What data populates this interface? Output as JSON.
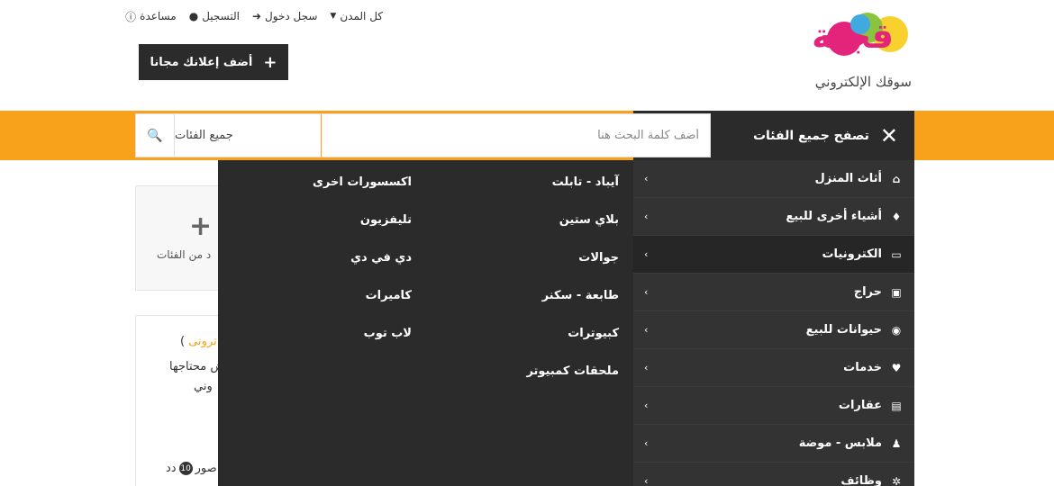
{
  "topnav": {
    "cities": "كل المدن",
    "login": "سجل دخول",
    "register": "التسجيل",
    "help": "مساعدة"
  },
  "logo": {
    "wordmark": "قجنة",
    "tagline": "سوقك الإلكتروني"
  },
  "post_ad": {
    "label": "أضف إعلانك مجانا",
    "icon": "plus-icon"
  },
  "browse": {
    "label": "تصفح جميع الفئات",
    "icon": "close-icon"
  },
  "search": {
    "placeholder": "أضف كلمة البحث هنا",
    "category_selected": "جميع الفئات",
    "icon": "search-icon"
  },
  "categories": [
    {
      "label": "أثاث المنزل",
      "icon": "home-icon"
    },
    {
      "label": "أشياء أخرى للبيع",
      "icon": "bell-icon"
    },
    {
      "label": "الكترونيات",
      "icon": "monitor-icon",
      "active": true
    },
    {
      "label": "حراج",
      "icon": "car-icon"
    },
    {
      "label": "حيوانات للبيع",
      "icon": "cat-icon"
    },
    {
      "label": "خدمات",
      "icon": "heart-icon"
    },
    {
      "label": "عقارات",
      "icon": "bank-icon"
    },
    {
      "label": "ملابس - موضة",
      "icon": "person-icon"
    },
    {
      "label": "وظائف",
      "icon": "gears-icon"
    }
  ],
  "subcategories": {
    "col1": [
      "آيباد - تابلت",
      "بلاي ستين",
      "جوالات",
      "طابعة - سكنر",
      "كبيوترات",
      "ملحقات كمبيوتر"
    ],
    "col2": [
      "اكسسورات اخرى",
      "تليفزيون",
      "دي في دي",
      "كاميرات",
      "لاب توب"
    ]
  },
  "background": {
    "more_text": "د من الفئات",
    "t1_prefix": ")",
    "t1_orange": "ترونى",
    "t2": "ش محتاجها",
    "t3": "وني",
    "photos_count": "10",
    "photos_prefix": "دد",
    "photos_suffix": "صور"
  },
  "colors": {
    "accent": "#f7a21a",
    "dark": "#2b2b2b",
    "brand": "#e3247a"
  }
}
